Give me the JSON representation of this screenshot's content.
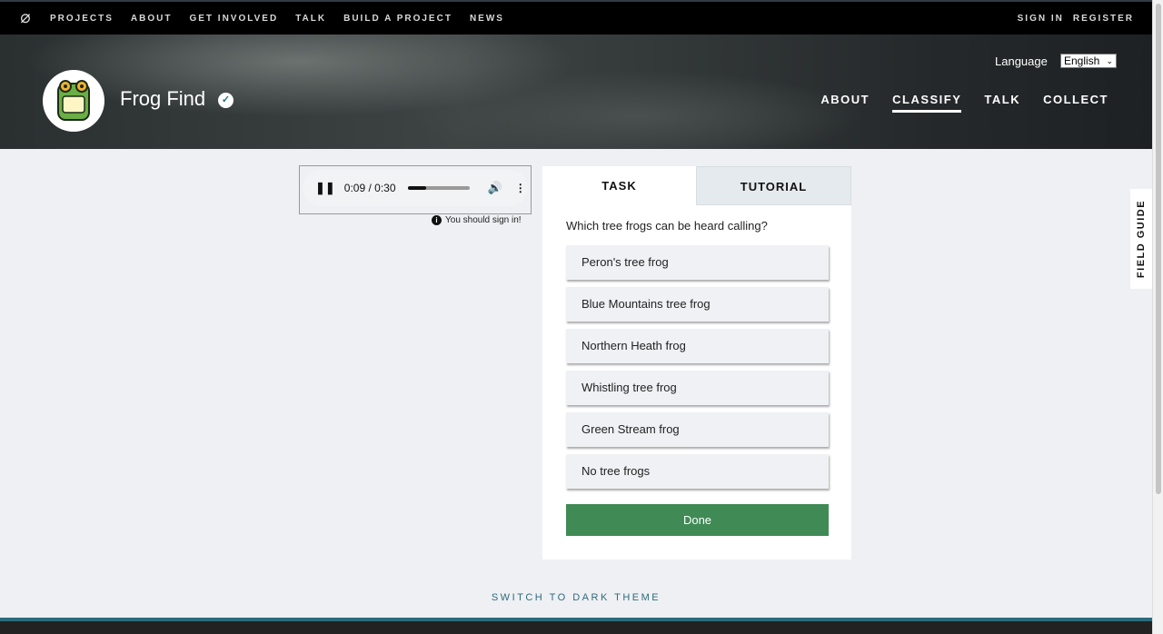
{
  "topnav": {
    "items": [
      "PROJECTS",
      "ABOUT",
      "GET INVOLVED",
      "TALK",
      "BUILD A PROJECT",
      "NEWS"
    ],
    "sign_in": "SIGN IN",
    "register": "REGISTER"
  },
  "project": {
    "title": "Frog Find",
    "language_label": "Language",
    "language": "English",
    "nav": [
      "ABOUT",
      "CLASSIFY",
      "TALK",
      "COLLECT"
    ]
  },
  "player": {
    "time": "0:09 / 0:30",
    "progress": 0.3,
    "notice": "You should sign in!"
  },
  "task": {
    "tabs": [
      "TASK",
      "TUTORIAL"
    ],
    "question": "Which tree frogs can be heard calling?",
    "options": [
      "Peron's tree frog",
      "Blue Mountains tree frog",
      "Northern Heath frog",
      "Whistling tree frog",
      "Green Stream frog",
      "No tree frogs"
    ],
    "done": "Done"
  },
  "field_guide": "FIELD GUIDE",
  "theme_toggle": "SWITCH TO DARK THEME"
}
